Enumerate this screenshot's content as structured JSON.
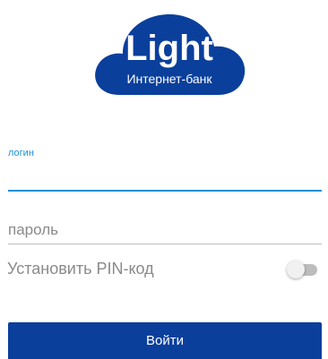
{
  "logo": {
    "title": "Light",
    "subtitle": "Интернет-банк",
    "color": "#0a3f9c"
  },
  "login": {
    "label": "логин",
    "value": "",
    "placeholder": ""
  },
  "password": {
    "placeholder": "пароль",
    "value": ""
  },
  "pin": {
    "label": "Установить PIN-код",
    "enabled": false
  },
  "submit": {
    "label": "Войти",
    "color": "#0a3f9c"
  },
  "colors": {
    "accent": "#1f8fd6"
  }
}
